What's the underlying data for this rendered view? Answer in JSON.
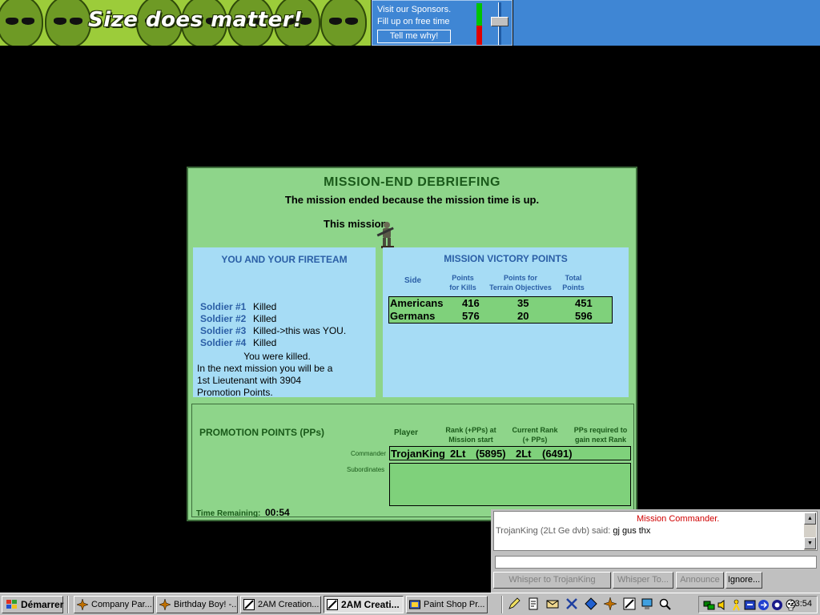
{
  "banner": {
    "slogan": "Size does matter!",
    "sponsor_line1": "Visit our Sponsors.",
    "sponsor_line2": "Fill up on free time",
    "tell_button": "Tell me why!"
  },
  "debrief": {
    "title": "MISSION-END DEBRIEFING",
    "subtitle": "The mission ended because the mission time is up.",
    "this_mission": "This mission",
    "fireteam": {
      "title": "YOU AND YOUR FIRETEAM",
      "soldiers": [
        {
          "label": "Soldier #1",
          "status": "Killed"
        },
        {
          "label": "Soldier #2",
          "status": "Killed"
        },
        {
          "label": "Soldier #3",
          "status": "Killed->this was YOU."
        },
        {
          "label": "Soldier #4",
          "status": "Killed"
        }
      ],
      "you_killed": "You were killed.",
      "next_line1": "In the next mission you will be a",
      "next_line2": "1st Lieutenant with 3904",
      "next_line3": "Promotion Points."
    },
    "victory": {
      "title": "MISSION VICTORY POINTS",
      "headers": {
        "side": "Side",
        "kills_1": "Points",
        "kills_2": "for Kills",
        "terrain_1": "Points for",
        "terrain_2": "Terrain Objectives",
        "total_1": "Total",
        "total_2": "Points"
      },
      "rows": [
        {
          "side": "Americans",
          "kills": "416",
          "terrain": "35",
          "total": "451"
        },
        {
          "side": "Germans",
          "kills": "576",
          "terrain": "20",
          "total": "596"
        }
      ]
    },
    "promotion": {
      "title": "PROMOTION POINTS (PPs)",
      "headers": {
        "player": "Player",
        "rank_start_1": "Rank (+PPs) at",
        "rank_start_2": "Mission start",
        "current_1": "Current Rank",
        "current_2": "(+ PPs)",
        "required_1": "PPs required to",
        "required_2": "gain next Rank"
      },
      "commander_label": "Commander",
      "subordinates_label": "Subordinates",
      "commander": {
        "player": "TrojanKing",
        "start_rank": "2Lt",
        "start_pps": "(5895)",
        "current_rank": "2Lt",
        "current_pps": "(6491)"
      },
      "time_label": "Time Remaining:",
      "time_value": "00:54"
    }
  },
  "chat": {
    "message1": "Mission Commander.",
    "message2_who": "TrojanKing (2Lt Ge dvb) said:",
    "message2_text": " gj gus thx",
    "input_value": "",
    "buttons": [
      "Whisper to TrojanKing",
      "Whisper To...",
      "Announce",
      "Ignore..."
    ]
  },
  "taskbar": {
    "start_label": "Démarrer",
    "tasks": [
      "Company Par...",
      "Birthday Boy! -...",
      "2AM Creation...",
      "2AM Creati...",
      "Paint Shop Pr..."
    ],
    "clock": "23:54"
  }
}
